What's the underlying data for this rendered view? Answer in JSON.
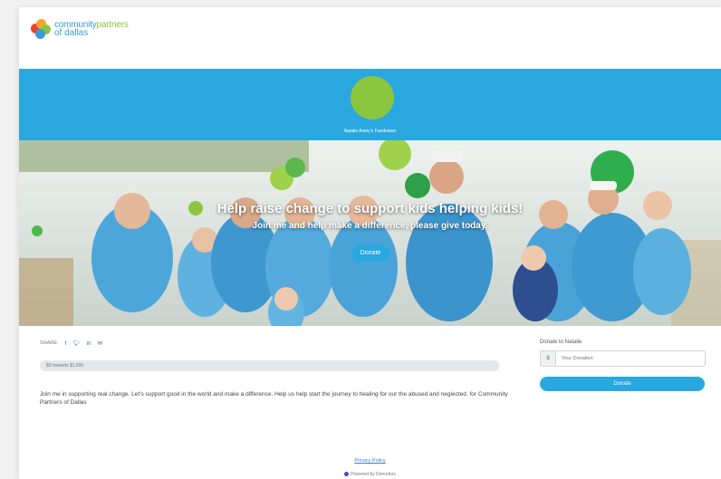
{
  "brand": {
    "line1_a": "community",
    "line1_b": "partners",
    "line2": "of dallas"
  },
  "banner": {
    "fundraiser_name": "Natalie Avery's Fundraiser",
    "accent": "#29a8e0",
    "avatar_color": "#8cc63f"
  },
  "hero": {
    "title": "Help raise change to support kids helping kids!",
    "subtitle": "Join me and help make a difference, please give today.",
    "button": "Donate"
  },
  "share": {
    "label": "SHARE:",
    "icons": [
      "facebook-icon",
      "twitter-icon",
      "linkedin-icon",
      "email-icon"
    ]
  },
  "progress": {
    "text": "$0 towards $1,000",
    "raised": 0,
    "goal": 1000
  },
  "description": "Join me in supporting real change. Let's support good in the world and make a difference. Help us help start the journey to healing for our the abused and neglected. for Community Partners of Dallas",
  "donate": {
    "label": "Donate to Natalie",
    "currency": "$",
    "placeholder": "Your Donation",
    "button": "Donate"
  },
  "footer": {
    "privacy": "Privacy Policy",
    "powered": "Powered by Donorbox"
  }
}
